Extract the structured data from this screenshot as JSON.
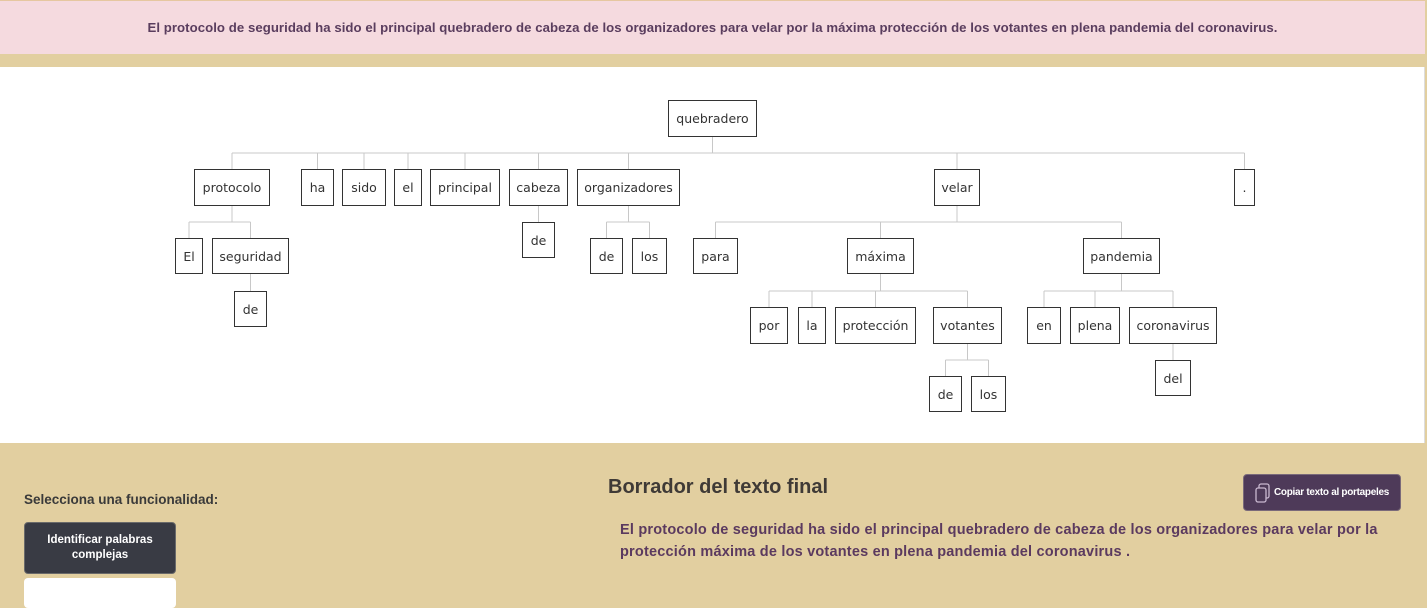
{
  "banner": {
    "sentence": "El protocolo de seguridad ha sido el principal quebradero de cabeza de los organizadores para velar por la máxima protección de los votantes en plena pandemia del coronavirus."
  },
  "tree": {
    "nodes": [
      {
        "id": "quebradero",
        "label": "quebradero"
      },
      {
        "id": "protocolo",
        "label": "protocolo"
      },
      {
        "id": "ha",
        "label": "ha"
      },
      {
        "id": "sido",
        "label": "sido"
      },
      {
        "id": "el",
        "label": "el"
      },
      {
        "id": "principal",
        "label": "principal"
      },
      {
        "id": "cabeza",
        "label": "cabeza"
      },
      {
        "id": "organizadores",
        "label": "organizadores"
      },
      {
        "id": "velar",
        "label": "velar"
      },
      {
        "id": "punto",
        "label": "."
      },
      {
        "id": "El",
        "label": "El"
      },
      {
        "id": "seguridad",
        "label": "seguridad"
      },
      {
        "id": "de_seg",
        "label": "de"
      },
      {
        "id": "de_cab",
        "label": "de"
      },
      {
        "id": "de_org",
        "label": "de"
      },
      {
        "id": "los_org",
        "label": "los"
      },
      {
        "id": "para",
        "label": "para"
      },
      {
        "id": "maxima",
        "label": "máxima"
      },
      {
        "id": "pandemia",
        "label": "pandemia"
      },
      {
        "id": "por",
        "label": "por"
      },
      {
        "id": "la",
        "label": "la"
      },
      {
        "id": "proteccion",
        "label": "protección"
      },
      {
        "id": "votantes",
        "label": "votantes"
      },
      {
        "id": "de_vot",
        "label": "de"
      },
      {
        "id": "los_vot",
        "label": "los"
      },
      {
        "id": "en",
        "label": "en"
      },
      {
        "id": "plena",
        "label": "plena"
      },
      {
        "id": "coronavirus",
        "label": "coronavirus"
      },
      {
        "id": "del",
        "label": "del"
      }
    ],
    "edges": [
      [
        "quebradero",
        "protocolo"
      ],
      [
        "quebradero",
        "ha"
      ],
      [
        "quebradero",
        "sido"
      ],
      [
        "quebradero",
        "el"
      ],
      [
        "quebradero",
        "principal"
      ],
      [
        "quebradero",
        "cabeza"
      ],
      [
        "quebradero",
        "organizadores"
      ],
      [
        "quebradero",
        "velar"
      ],
      [
        "quebradero",
        "punto"
      ],
      [
        "protocolo",
        "El"
      ],
      [
        "protocolo",
        "seguridad"
      ],
      [
        "seguridad",
        "de_seg"
      ],
      [
        "cabeza",
        "de_cab"
      ],
      [
        "organizadores",
        "de_org"
      ],
      [
        "organizadores",
        "los_org"
      ],
      [
        "velar",
        "para"
      ],
      [
        "velar",
        "maxima"
      ],
      [
        "velar",
        "pandemia"
      ],
      [
        "maxima",
        "por"
      ],
      [
        "maxima",
        "la"
      ],
      [
        "maxima",
        "proteccion"
      ],
      [
        "maxima",
        "votantes"
      ],
      [
        "votantes",
        "de_vot"
      ],
      [
        "votantes",
        "los_vot"
      ],
      [
        "pandemia",
        "en"
      ],
      [
        "pandemia",
        "plena"
      ],
      [
        "pandemia",
        "coronavirus"
      ],
      [
        "coronavirus",
        "del"
      ]
    ]
  },
  "controls": {
    "select_label": "Selecciona una funcionalidad:",
    "identify_button": "Identificar palabras complejas"
  },
  "draft": {
    "title": "Borrador del texto final",
    "copy_button": "Copiar texto al portapeles",
    "copy_icon": "clipboard-icon",
    "text": "El protocolo de seguridad ha sido el principal quebradero de cabeza de los organizadores para velar por la protección máxima de los votantes en plena pandemia del coronavirus ."
  }
}
